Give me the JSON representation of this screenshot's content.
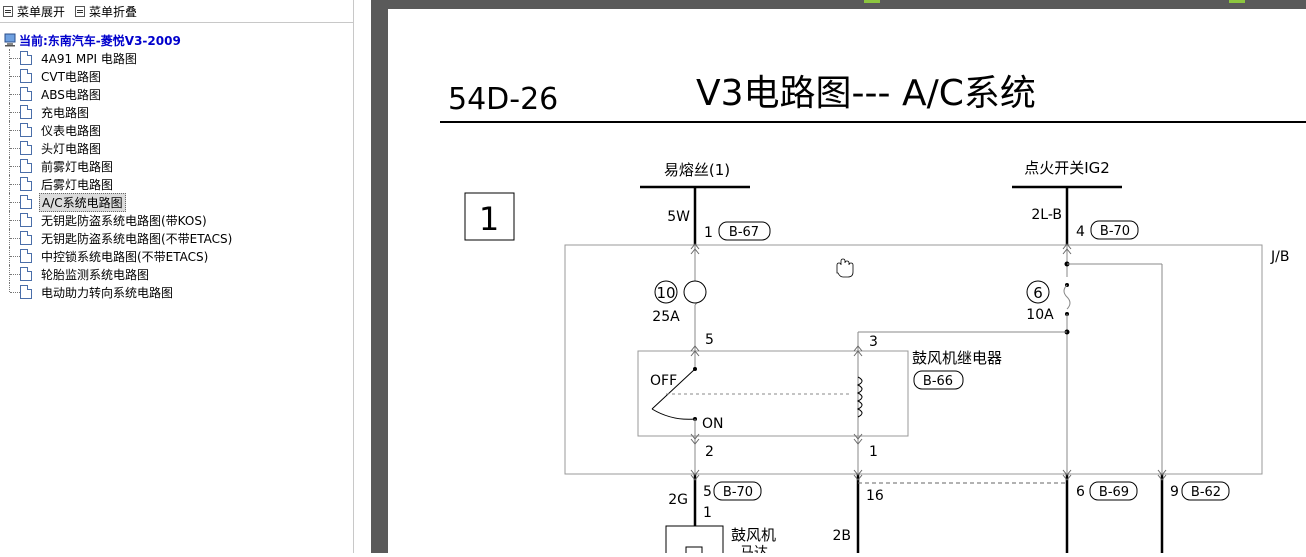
{
  "toolbar": {
    "expand_label": "菜单展开",
    "collapse_label": "菜单折叠"
  },
  "tree": {
    "root_label": "当前:东南汽车-菱悦V3-2009",
    "items": [
      {
        "label": "4A91 MPI 电路图"
      },
      {
        "label": "CVT电路图"
      },
      {
        "label": "ABS电路图"
      },
      {
        "label": "充电路图"
      },
      {
        "label": "仪表电路图"
      },
      {
        "label": "头灯电路图"
      },
      {
        "label": "前雾灯电路图"
      },
      {
        "label": "后雾灯电路图"
      },
      {
        "label": "A/C系统电路图",
        "selected": true
      },
      {
        "label": "无钥匙防盗系统电路图(带KOS)"
      },
      {
        "label": "无钥匙防盗系统电路图(不带ETACS)"
      },
      {
        "label": "中控锁系统电路图(不带ETACS)"
      },
      {
        "label": "轮胎监测系统电路图"
      },
      {
        "label": "电动助力转向系统电路图"
      }
    ]
  },
  "diagram": {
    "page_code": "54D-26",
    "title": "V3电路图--- A/C系统",
    "section_number": "1",
    "fuse_source_label": "易熔丝(1)",
    "ign_source_label": "点火开关IG2",
    "wire_5w": "5W",
    "wire_2lb": "2L-B",
    "wire_2g": "2G",
    "wire_2b": "2B",
    "pin_1": "1",
    "pin_4": "4",
    "pin_5": "5",
    "pin_3": "3",
    "pin_2": "2",
    "pin_16": "16",
    "pin_6": "6",
    "pin_9": "9",
    "conn_b67": "B-67",
    "conn_b70": "B-70",
    "conn_b66": "B-66",
    "conn_b69": "B-69",
    "conn_b62": "B-62",
    "jb_label": "J/B",
    "fuse10_num": "10",
    "fuse10_rating": "25A",
    "fuse6_num": "6",
    "fuse6_rating": "10A",
    "relay_label": "鼓风机继电器",
    "switch_off": "OFF",
    "switch_on": "ON",
    "motor_label": "鼓风机",
    "motor_sub": "马达"
  },
  "colors": {
    "tree_root": "#0000cc",
    "right_bg": "#5a5a5a",
    "marker": "#8cc63f"
  }
}
